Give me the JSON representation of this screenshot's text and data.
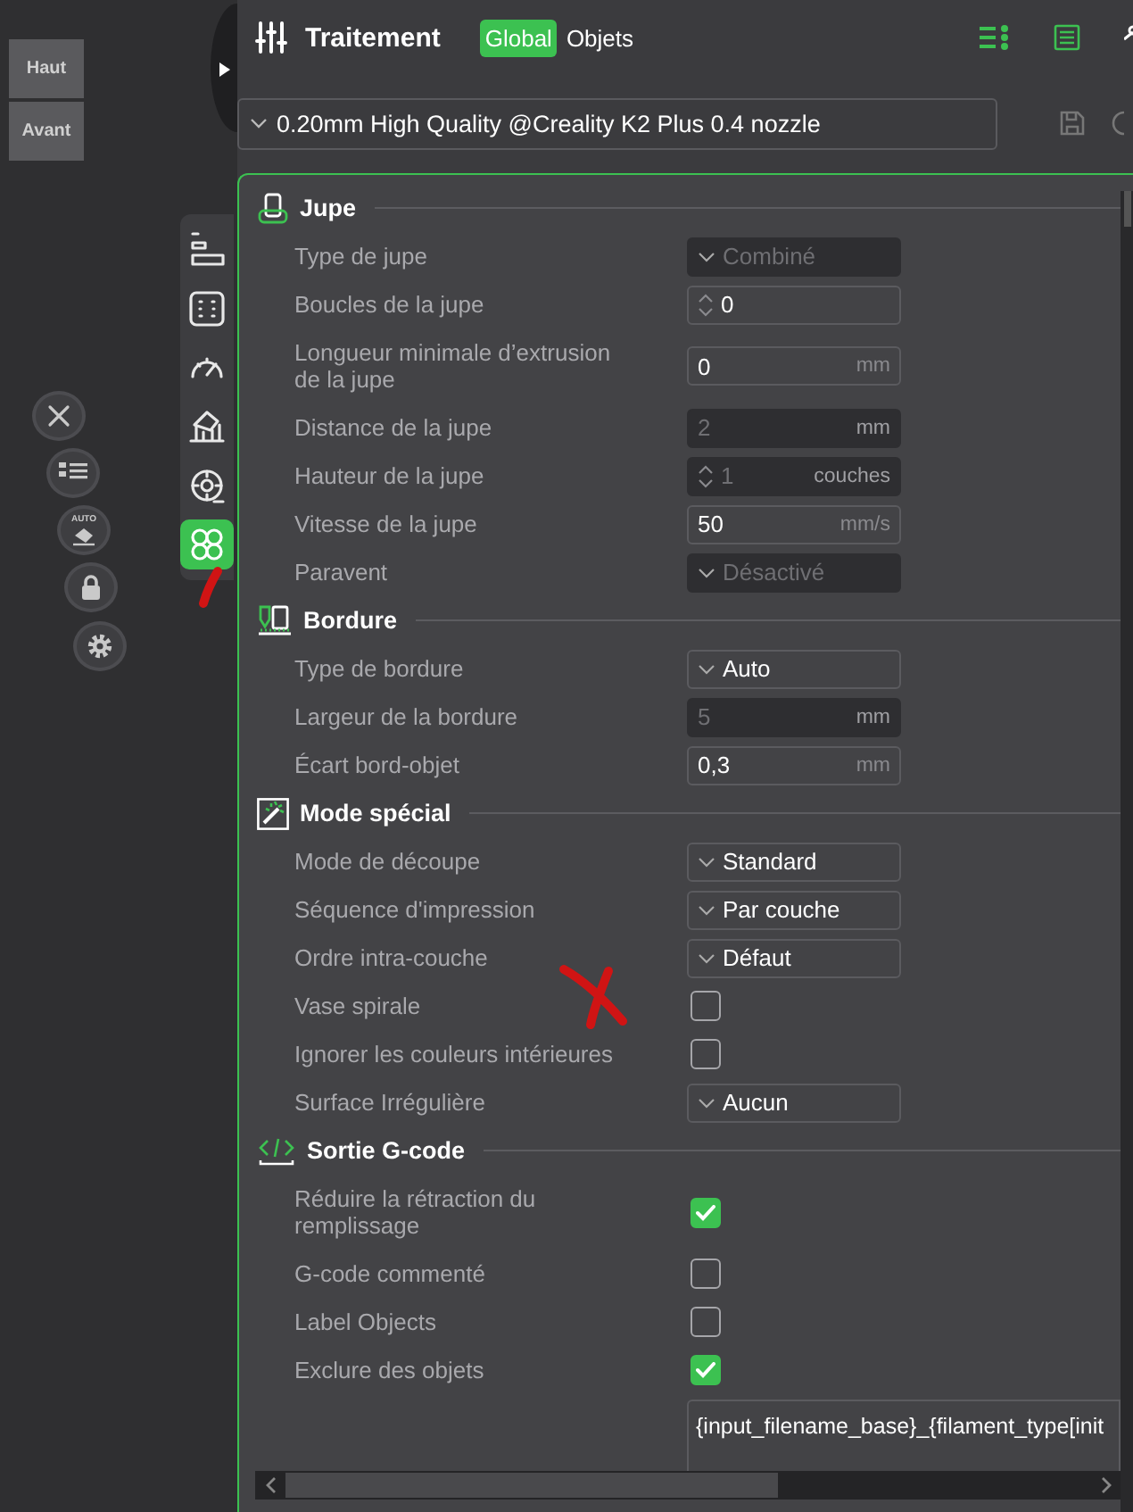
{
  "viewport": {
    "view_cube": [
      "Haut",
      "Avant"
    ],
    "tools": [
      {
        "kind": "layers",
        "selected": false
      },
      {
        "kind": "frame",
        "selected": false
      },
      {
        "kind": "speed",
        "selected": false
      },
      {
        "kind": "support",
        "selected": false
      },
      {
        "kind": "filament",
        "selected": false
      },
      {
        "kind": "others",
        "selected": true
      }
    ],
    "floating_buttons": [
      {
        "kind": "close"
      },
      {
        "kind": "list"
      },
      {
        "kind": "auto",
        "label": "AUTO"
      },
      {
        "kind": "lock"
      },
      {
        "kind": "gear"
      }
    ]
  },
  "header": {
    "title": "Traitement",
    "scope_tabs": [
      {
        "label": "Global",
        "selected": true
      },
      {
        "label": "Objets",
        "selected": false
      }
    ],
    "preset": "0.20mm High Quality @Creality K2 Plus 0.4 nozzle"
  },
  "sections": [
    {
      "kind": "skirt",
      "title": "Jupe",
      "rows": [
        {
          "label": "Type de jupe",
          "kind": "combo",
          "value": "Combiné",
          "disabled": true
        },
        {
          "label": "Boucles de la jupe",
          "kind": "spin",
          "value": "0",
          "disabled": false
        },
        {
          "label": "Longueur minimale d’extrusion de la jupe",
          "kind": "number",
          "value": "0",
          "unit": "mm",
          "disabled": false
        },
        {
          "label": "Distance de la jupe",
          "kind": "number",
          "value": "2",
          "unit": "mm",
          "disabled": true
        },
        {
          "label": "Hauteur de la jupe",
          "kind": "spin",
          "value": "1",
          "unit": "couches",
          "disabled": true
        },
        {
          "label": "Vitesse de la jupe",
          "kind": "number",
          "value": "50",
          "unit": "mm/s",
          "disabled": false
        },
        {
          "label": "Paravent",
          "kind": "combo",
          "value": "Désactivé",
          "disabled": true
        }
      ]
    },
    {
      "kind": "brim",
      "title": "Bordure",
      "rows": [
        {
          "label": "Type de bordure",
          "kind": "combo",
          "value": "Auto",
          "disabled": false
        },
        {
          "label": "Largeur de la bordure",
          "kind": "number",
          "value": "5",
          "unit": "mm",
          "disabled": true
        },
        {
          "label": "Écart bord-objet",
          "kind": "number",
          "value": "0,3",
          "unit": "mm",
          "disabled": false
        }
      ]
    },
    {
      "kind": "special",
      "title": "Mode spécial",
      "rows": [
        {
          "label": "Mode de découpe",
          "kind": "combo",
          "value": "Standard",
          "disabled": false
        },
        {
          "label": "Séquence d'impression",
          "kind": "combo",
          "value": "Par couche",
          "disabled": false
        },
        {
          "label": "Ordre intra-couche",
          "kind": "combo",
          "value": "Défaut",
          "disabled": false
        },
        {
          "label": "Vase spirale",
          "kind": "checkbox",
          "checked": false
        },
        {
          "label": "Ignorer les couleurs intérieures",
          "kind": "checkbox",
          "checked": false
        },
        {
          "label": "Surface Irrégulière",
          "kind": "combo",
          "value": "Aucun",
          "disabled": false
        }
      ]
    },
    {
      "kind": "gcode",
      "title": "Sortie G-code",
      "rows": [
        {
          "label": "Réduire la rétraction du remplissage",
          "kind": "checkbox",
          "checked": true
        },
        {
          "label": "G-code commenté",
          "kind": "checkbox",
          "checked": false
        },
        {
          "label": "Label Objects",
          "kind": "checkbox",
          "checked": false
        },
        {
          "label": "Exclure des objets",
          "kind": "checkbox",
          "checked": true
        },
        {
          "kind": "text",
          "value": "{input_filename_base}_{filament_type[init"
        }
      ]
    }
  ]
}
